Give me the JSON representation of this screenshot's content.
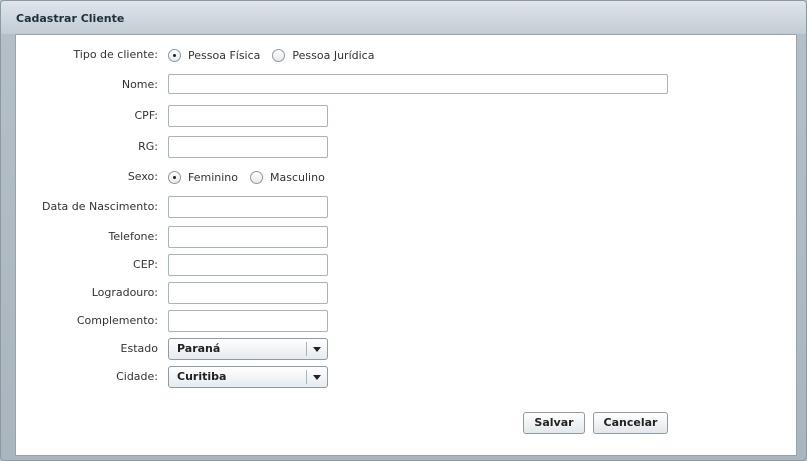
{
  "dialog": {
    "title": "Cadastrar Cliente"
  },
  "form": {
    "tipo_cliente": {
      "label": "Tipo de cliente:",
      "options": [
        "Pessoa Física",
        "Pessoa Jurídica"
      ],
      "selected": "Pessoa Física"
    },
    "nome": {
      "label": "Nome:",
      "value": ""
    },
    "cpf": {
      "label": "CPF:",
      "value": ""
    },
    "rg": {
      "label": "RG:",
      "value": ""
    },
    "sexo": {
      "label": "Sexo:",
      "options": [
        "Feminino",
        "Masculino"
      ],
      "selected": "Feminino"
    },
    "data_nascimento": {
      "label": "Data de Nascimento:",
      "value": ""
    },
    "telefone": {
      "label": "Telefone:",
      "value": ""
    },
    "cep": {
      "label": "CEP:",
      "value": ""
    },
    "logradouro": {
      "label": "Logradouro:",
      "value": ""
    },
    "complemento": {
      "label": "Complemento:",
      "value": ""
    },
    "estado": {
      "label": "Estado",
      "value": "Paraná"
    },
    "cidade": {
      "label": "Cidade:",
      "value": "Curitiba"
    }
  },
  "buttons": {
    "save": "Salvar",
    "cancel": "Cancelar"
  }
}
